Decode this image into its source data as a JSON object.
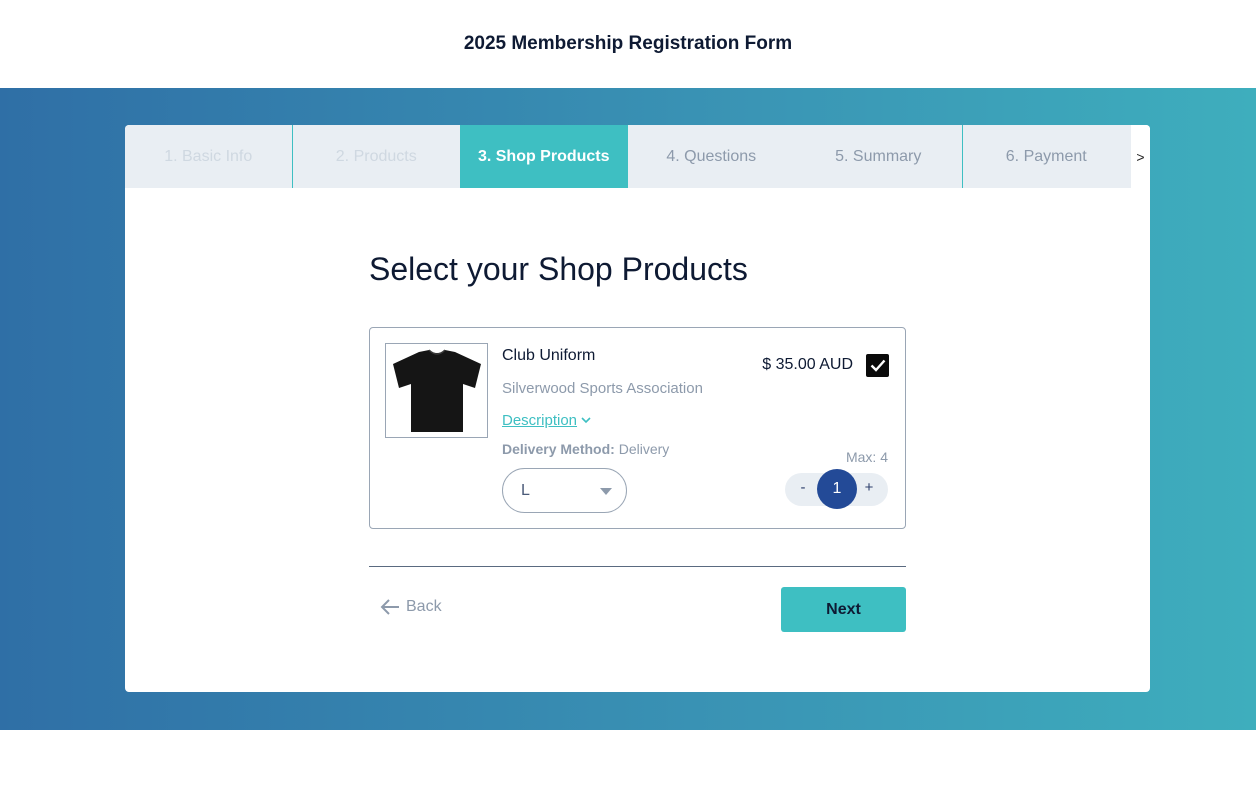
{
  "header": {
    "title": "2025 Membership Registration Form"
  },
  "steps": [
    {
      "label": "1. Basic Info",
      "state": "done"
    },
    {
      "label": "2. Products",
      "state": "done"
    },
    {
      "label": "3. Shop Products",
      "state": "active"
    },
    {
      "label": "4. Questions",
      "state": "todo"
    },
    {
      "label": "5. Summary",
      "state": "todo"
    },
    {
      "label": "6. Payment",
      "state": "todo"
    }
  ],
  "steps_next": ">",
  "main": {
    "heading": "Select your Shop Products",
    "product": {
      "name": "Club Uniform",
      "organisation": "Silverwood Sports Association",
      "description_link": "Description",
      "delivery_label": "Delivery Method:",
      "delivery_value": "Delivery",
      "size_selected": "L",
      "price": "$ 35.00 AUD",
      "selected": true,
      "max_label": "Max: 4",
      "quantity": "1",
      "minus": "-",
      "plus": "+",
      "image_icon": "tshirt-icon"
    },
    "back_label": "Back",
    "next_label": "Next"
  },
  "colors": {
    "accent": "#3ebfc2",
    "navy": "#234a97",
    "band_start": "#2f6fa6",
    "band_end": "#3eaebd"
  }
}
